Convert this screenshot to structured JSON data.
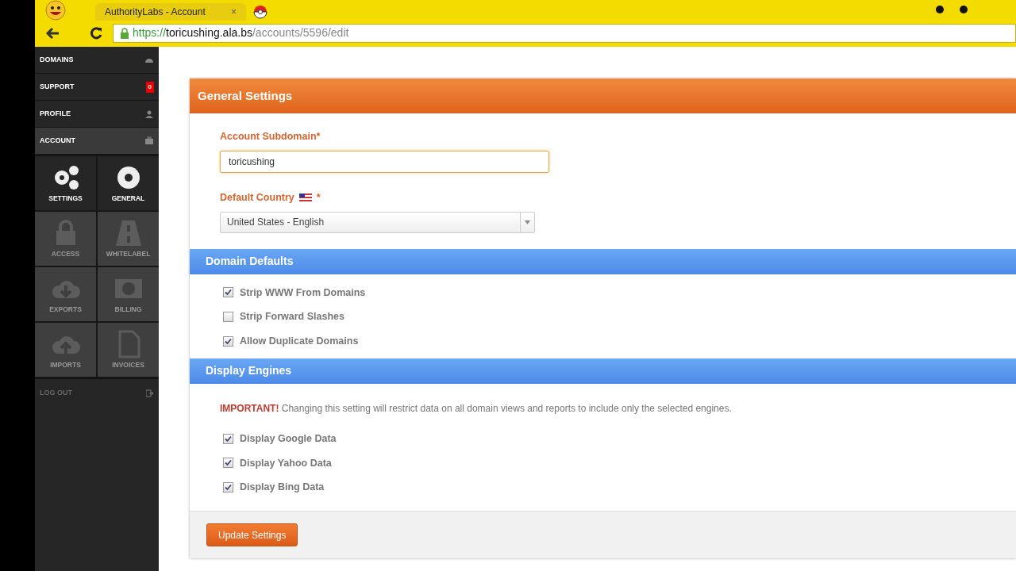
{
  "browser": {
    "tab_title": "AuthorityLabs - Account",
    "tab_close": "×",
    "url_scheme": "https://",
    "url_host": "toricushing.ala.bs",
    "url_path": "/accounts/5596/edit"
  },
  "sidebar": {
    "items": [
      {
        "label": "DOMAINS",
        "selected": false
      },
      {
        "label": "SUPPORT",
        "badge": "0",
        "selected": false
      },
      {
        "label": "PROFILE",
        "selected": false
      },
      {
        "label": "ACCOUNT",
        "selected": true
      }
    ],
    "tiles": [
      {
        "label": "SETTINGS",
        "disabled": false
      },
      {
        "label": "GENERAL",
        "disabled": false
      },
      {
        "label": "ACCESS",
        "disabled": true
      },
      {
        "label": "WHITELABEL",
        "disabled": true
      },
      {
        "label": "EXPORTS",
        "disabled": true
      },
      {
        "label": "BILLING",
        "disabled": true
      },
      {
        "label": "IMPORTS",
        "disabled": true
      },
      {
        "label": "INVOICES",
        "disabled": true
      }
    ],
    "logout": "LOG OUT"
  },
  "general": {
    "title": "General Settings",
    "subdomain_label": "Account Subdomain*",
    "subdomain_value": "toricushing",
    "country_label": "Default Country",
    "country_required": "*",
    "country_value": "United States - English"
  },
  "domain_defaults": {
    "title": "Domain Defaults",
    "options": [
      {
        "label": "Strip WWW From Domains",
        "checked": true
      },
      {
        "label": "Strip Forward Slashes",
        "checked": false
      },
      {
        "label": "Allow Duplicate Domains",
        "checked": true
      }
    ]
  },
  "display_engines": {
    "title": "Display Engines",
    "notice_strong": "IMPORTANT!",
    "notice": "Changing this setting will restrict data on all domain views and reports to include only the selected engines.",
    "options": [
      {
        "label": "Display Google Data",
        "checked": true
      },
      {
        "label": "Display Yahoo Data",
        "checked": true
      },
      {
        "label": "Display Bing Data",
        "checked": true
      }
    ]
  },
  "submit": "Update Settings"
}
